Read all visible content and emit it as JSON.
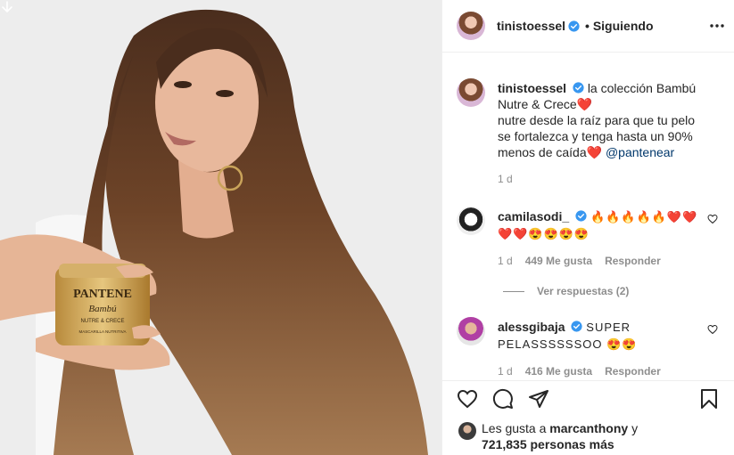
{
  "post": {
    "username": "tinistoessel",
    "follow_status": "Siguiendo",
    "caption_text": "la colección Bambú Nutre & Crece",
    "caption_text_2": "nutre desde la raíz para que tu pelo se fortalezca y tenga hasta un 90% menos de caída",
    "caption_mention": "@pantenear",
    "caption_time": "1 d"
  },
  "product": {
    "brand": "PANTENE",
    "line": "Bambú",
    "sub": "NUTRE & CRECE",
    "type": "MASCARILLA NUTRITIVA"
  },
  "comments": [
    {
      "username": "camilasodi_",
      "text": "🔥🔥🔥🔥🔥❤️❤️❤️❤️😍😍😍😍",
      "time": "1 d",
      "likes": "449 Me gusta",
      "reply": "Responder",
      "view_replies": "Ver respuestas (2)"
    },
    {
      "username": "alessgibaja",
      "text": "SUPER PELASSSSSSOO 😍😍",
      "time": "1 d",
      "likes": "416 Me gusta",
      "reply": "Responder"
    }
  ],
  "footer": {
    "likes_prefix": "Les gusta a",
    "likes_user": "marcanthony",
    "likes_suffix": "y",
    "likes_others": "721,835 personas más"
  },
  "icons": {
    "verified": "verified-badge-icon",
    "more": "more-options-icon",
    "like": "heart-icon",
    "comment": "comment-icon",
    "share": "share-icon",
    "save": "bookmark-icon"
  },
  "colors": {
    "verified_blue": "#3897f0",
    "text": "#262626",
    "muted": "#8e8e8e",
    "link": "#00376b"
  }
}
